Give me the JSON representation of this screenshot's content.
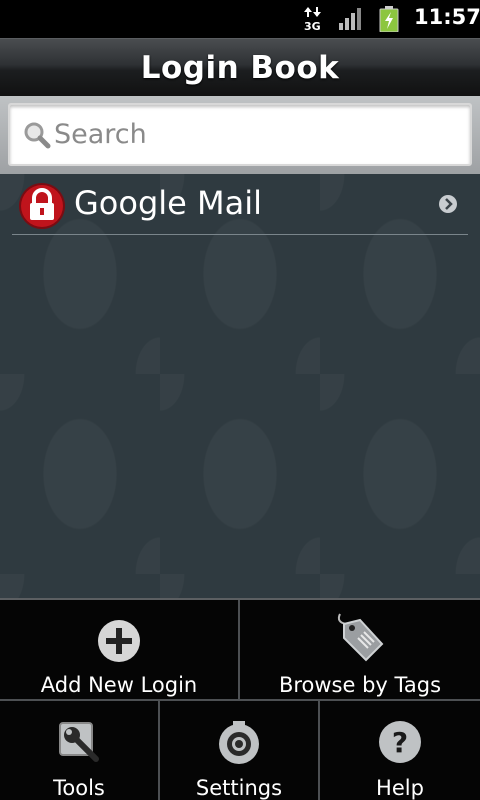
{
  "status_bar": {
    "network_label": "3G",
    "time": "11:57",
    "icons": [
      "data-arrows-icon",
      "signal-icon",
      "battery-charging-icon"
    ]
  },
  "header": {
    "title": "Login Book"
  },
  "search": {
    "placeholder": "Search",
    "value": ""
  },
  "list": {
    "items": [
      {
        "name": "Google Mail",
        "icon": "lock-icon",
        "chevron": "chevron-right-icon"
      }
    ]
  },
  "menu": {
    "items": [
      {
        "label": "Add New Login",
        "icon": "add-icon"
      },
      {
        "label": "Browse by Tags",
        "icon": "tag-icon"
      },
      {
        "label": "Tools",
        "icon": "wrench-icon"
      },
      {
        "label": "Settings",
        "icon": "settings-icon"
      },
      {
        "label": "Help",
        "icon": "help-icon"
      }
    ]
  },
  "colors": {
    "lock_red": "#c0141c",
    "list_background": "#2f3a40",
    "menu_background": "#050505"
  }
}
